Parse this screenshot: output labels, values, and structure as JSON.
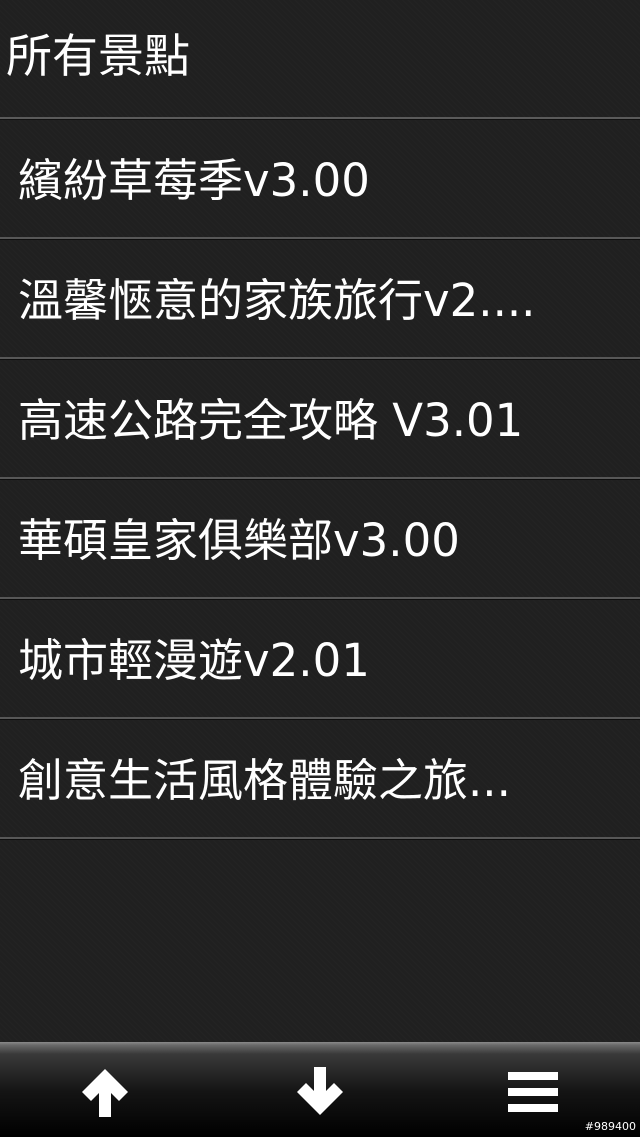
{
  "header": {
    "title": "所有景點"
  },
  "list": {
    "items": [
      {
        "label": "繽紛草莓季v3.00"
      },
      {
        "label": "溫馨愜意的家族旅行v2...."
      },
      {
        "label": "高速公路完全攻略 V3.01"
      },
      {
        "label": "華碩皇家俱樂部v3.00"
      },
      {
        "label": "城市輕漫遊v2.01"
      },
      {
        "label": "創意生活風格體驗之旅..."
      }
    ]
  },
  "toolbar": {
    "buttons": [
      {
        "icon": "arrow-up-icon"
      },
      {
        "icon": "arrow-down-icon"
      },
      {
        "icon": "menu-icon"
      }
    ]
  },
  "watermark": {
    "text": "#989400"
  },
  "colors": {
    "background": "#202020",
    "text": "#ffffff",
    "divider": "#575757",
    "icon": "#ffffff"
  }
}
